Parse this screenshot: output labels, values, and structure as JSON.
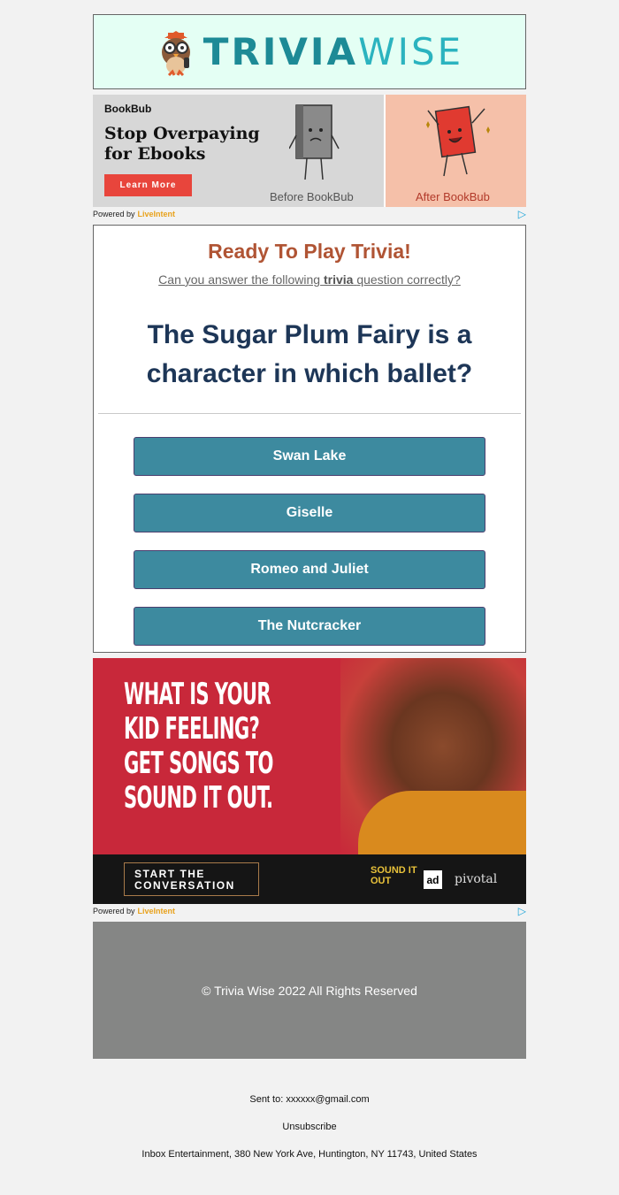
{
  "header": {
    "logo_part1": "TRIVIA",
    "logo_part2": "WISE",
    "bg_color": "#e4fff4"
  },
  "ad1": {
    "brand": "BookBub",
    "headline_line1": "Stop Overpaying",
    "headline_line2": "for Ebooks",
    "button_label": "Learn More",
    "before_label": "Before BookBub",
    "after_label": "After BookBub"
  },
  "powered_by": {
    "prefix": "Powered by",
    "brand": "LiveIntent"
  },
  "trivia": {
    "heading": "Ready To Play Trivia!",
    "subheading_pre": "Can you answer the following",
    "subheading_bold": "trivia",
    "subheading_post": "question correctly?",
    "question": "The Sugar Plum Fairy is a character in which ballet?",
    "answers": [
      "Swan Lake",
      "Giselle",
      "Romeo and Juliet",
      "The Nutcracker"
    ],
    "answer_color": "#3d8a9f",
    "heading_color": "#b05434",
    "question_color": "#1d3657"
  },
  "ad2": {
    "line1": "WHAT IS YOUR",
    "line2": "KID FEELING?",
    "line3": "GET SONGS TO",
    "line4": "SOUND IT OUT.",
    "cta_line1": "START THE",
    "cta_line2": "CONVERSATION",
    "brand1_line1": "SOUND IT",
    "brand1_line2": "OUT",
    "brand2": "ad",
    "brand3": "pivotal"
  },
  "footer": {
    "copyright": "© Trivia Wise 2022 All Rights Reserved",
    "sent_to": "Sent to: xxxxxx@gmail.com",
    "unsubscribe": "Unsubscribe",
    "address": "Inbox Entertainment, 380 New York Ave, Huntington, NY 11743, United States"
  }
}
